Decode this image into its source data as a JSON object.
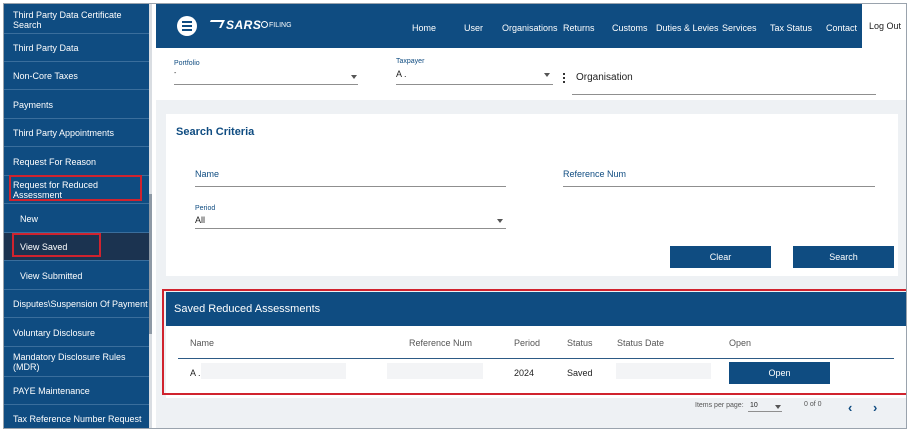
{
  "sidebar": {
    "items": [
      {
        "label": "Third Party Data Certificate Search"
      },
      {
        "label": "Third Party Data"
      },
      {
        "label": "Non-Core Taxes"
      },
      {
        "label": "Payments"
      },
      {
        "label": "Third Party Appointments"
      },
      {
        "label": "Request For Reason"
      },
      {
        "label": "Request for Reduced Assessment"
      },
      {
        "label": "New"
      },
      {
        "label": "View Saved"
      },
      {
        "label": "View Submitted"
      },
      {
        "label": "Disputes\\Suspension Of Payment"
      },
      {
        "label": "Voluntary Disclosure"
      },
      {
        "label": "Mandatory Disclosure Rules (MDR)"
      },
      {
        "label": "PAYE Maintenance"
      },
      {
        "label": "Tax Reference Number Request"
      }
    ]
  },
  "header": {
    "brand": "SARS",
    "sub_brand": "FILING",
    "nav": [
      "Home",
      "User",
      "Organisations",
      "Returns",
      "Customs",
      "Duties & Levies",
      "Services",
      "Tax Status",
      "Contact"
    ],
    "logout": "Log Out"
  },
  "selector": {
    "portfolio_label": "Portfolio",
    "portfolio_value": "-",
    "taxpayer_label": "Taxpayer",
    "taxpayer_value": "A .",
    "organisation": "Organisation"
  },
  "search": {
    "title": "Search Criteria",
    "name_label": "Name",
    "refnum_label": "Reference Num",
    "period_label": "Period",
    "period_value": "All",
    "clear": "Clear",
    "search": "Search"
  },
  "saved": {
    "title": "Saved Reduced Assessments",
    "columns": [
      "Name",
      "Reference Num",
      "Period",
      "Status",
      "Status Date",
      "Open"
    ],
    "rows": [
      {
        "name": "A .",
        "reference": "",
        "period": "2024",
        "status": "Saved",
        "status_date": "",
        "open": "Open"
      }
    ]
  },
  "pagination": {
    "items_label": "Items per page:",
    "items_value": "10",
    "range": "0 of 0"
  },
  "colors": {
    "primary": "#0f4c81",
    "highlight": "#d0232e"
  }
}
